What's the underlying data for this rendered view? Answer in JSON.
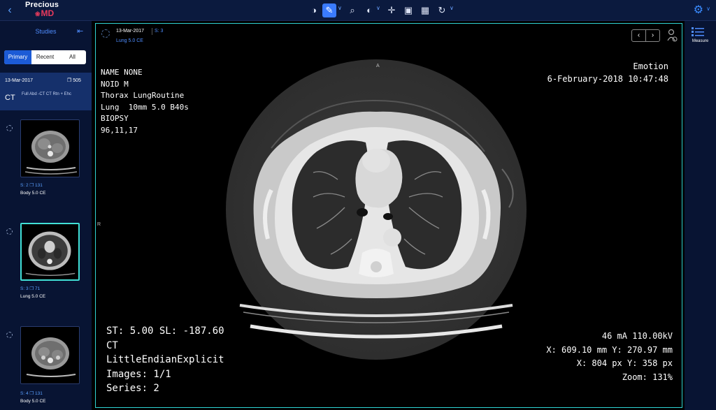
{
  "topbar": {
    "logo_line1": "Precious",
    "logo_line2": "MD",
    "tools": [
      "contrast-icon",
      "pencil-icon",
      "magnifier-icon",
      "window-level-icon",
      "pan-icon",
      "camera-icon",
      "layout-icon",
      "rotate-icon"
    ],
    "active_tool": "pencil-icon"
  },
  "sidebar": {
    "title": "Studies",
    "tabs": [
      "Primary",
      "Recent",
      "All"
    ],
    "active_tab": "Primary",
    "study": {
      "date": "13-Mar-2017",
      "count": "505",
      "modality": "CT",
      "description": "Full Abd -CT CT Rtn + Ehc"
    },
    "series": [
      {
        "number": "S: 2",
        "images": "131",
        "name": "Body 5.0 CE"
      },
      {
        "number": "S: 3",
        "images": "71",
        "name": "Lung 5.0 CE",
        "selected": true
      },
      {
        "number": "S: 4",
        "images": "131",
        "name": "Body 5.0 CE"
      }
    ]
  },
  "viewport": {
    "header_date": "13-Mar-2017",
    "header_series": "S: 3",
    "header_name": "Lung 5.0 CE",
    "overlay_top_left": [
      "NAME NONE",
      "NOID M",
      "Thorax LungRoutine",
      "Lung  10mm 5.0 B40s",
      "BIOPSY",
      "96,11,17"
    ],
    "overlay_top_right": [
      "Emotion",
      "6-February-2018 10:47:48"
    ],
    "overlay_bottom_left": [
      "ST: 5.00 SL: -187.60",
      "CT",
      "LittleEndianExplicit",
      "Images: 1/1",
      "Series: 2"
    ],
    "overlay_bottom_right": [
      "46 mA 110.00kV",
      "X: 609.10 mm Y: 270.97 mm",
      "X: 804 px Y: 358 px",
      "Zoom: 131%"
    ],
    "orientation_top": "A",
    "orientation_left": "R"
  },
  "rightpanel": {
    "measure_label": "Measure"
  },
  "colors": {
    "topbar_bg": "#0b1a3e",
    "sidebar_bg": "#081433",
    "accent": "#1c5bd6",
    "viewport_border": "#2fd3d3",
    "brand_red": "#e83a5c"
  }
}
